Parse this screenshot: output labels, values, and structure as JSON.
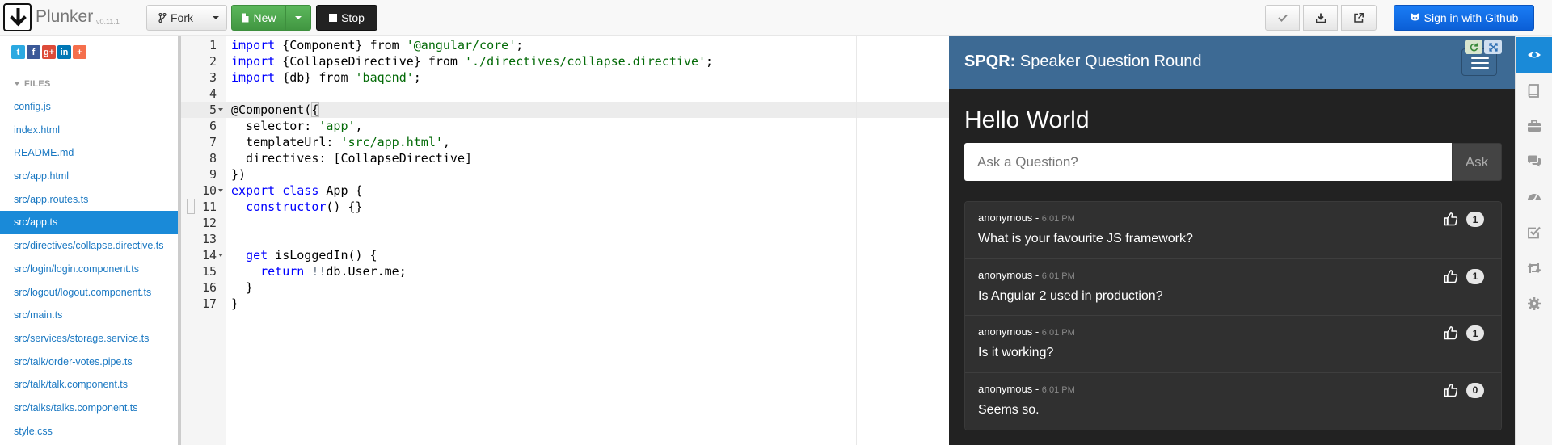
{
  "app": {
    "name": "Plunker",
    "version": "v0.11.1"
  },
  "toolbar": {
    "fork_label": "Fork",
    "new_label": "New",
    "stop_label": "Stop",
    "signin_label": "Sign in with Github"
  },
  "social": {
    "items": [
      {
        "icon": "twitter-icon",
        "glyph": "t",
        "color": "#2ba9e1"
      },
      {
        "icon": "facebook-icon",
        "glyph": "f",
        "color": "#3b5998"
      },
      {
        "icon": "google-plus-icon",
        "glyph": "g+",
        "color": "#dd4b39"
      },
      {
        "icon": "linkedin-icon",
        "glyph": "in",
        "color": "#0077b5"
      },
      {
        "icon": "share-plus-icon",
        "glyph": "+",
        "color": "#f56f4c"
      }
    ]
  },
  "files": {
    "header": "FILES",
    "items": [
      {
        "name": "config.js"
      },
      {
        "name": "index.html"
      },
      {
        "name": "README.md"
      },
      {
        "name": "src/app.html"
      },
      {
        "name": "src/app.routes.ts"
      },
      {
        "name": "src/app.ts",
        "active": true
      },
      {
        "name": "src/directives/collapse.directive.ts"
      },
      {
        "name": "src/login/login.component.ts"
      },
      {
        "name": "src/logout/logout.component.ts"
      },
      {
        "name": "src/main.ts"
      },
      {
        "name": "src/services/storage.service.ts"
      },
      {
        "name": "src/talk/order-votes.pipe.ts"
      },
      {
        "name": "src/talk/talk.component.ts"
      },
      {
        "name": "src/talks/talks.component.ts"
      },
      {
        "name": "style.css"
      }
    ]
  },
  "editor": {
    "active_line": 5,
    "fold_lines": [
      5,
      10,
      14
    ],
    "lines": [
      [
        [
          "k",
          "import"
        ],
        [
          "p",
          " {Component} from "
        ],
        [
          "s",
          "'@angular/core'"
        ],
        [
          "p",
          ";"
        ]
      ],
      [
        [
          "k",
          "import"
        ],
        [
          "p",
          " {CollapseDirective} from "
        ],
        [
          "s",
          "'./directives/collapse.directive'"
        ],
        [
          "p",
          ";"
        ]
      ],
      [
        [
          "k",
          "import"
        ],
        [
          "p",
          " {db} from "
        ],
        [
          "s",
          "'baqend'"
        ],
        [
          "p",
          ";"
        ]
      ],
      [],
      [
        [
          "p",
          "@Component({"
        ]
      ],
      [
        [
          "p",
          "  selector: "
        ],
        [
          "s",
          "'app'"
        ],
        [
          "p",
          ","
        ]
      ],
      [
        [
          "p",
          "  templateUrl: "
        ],
        [
          "s",
          "'src/app.html'"
        ],
        [
          "p",
          ","
        ]
      ],
      [
        [
          "p",
          "  directives: [CollapseDirective]"
        ]
      ],
      [
        [
          "p",
          "})"
        ]
      ],
      [
        [
          "k",
          "export"
        ],
        [
          "p",
          " "
        ],
        [
          "k",
          "class"
        ],
        [
          "p",
          " App {"
        ]
      ],
      [
        [
          "p",
          "  "
        ],
        [
          "k",
          "constructor"
        ],
        [
          "p",
          "() {}"
        ]
      ],
      [],
      [],
      [
        [
          "p",
          "  "
        ],
        [
          "k",
          "get"
        ],
        [
          "p",
          " isLoggedIn() {"
        ]
      ],
      [
        [
          "p",
          "    "
        ],
        [
          "k",
          "return"
        ],
        [
          "p",
          " "
        ],
        [
          "o",
          "!!"
        ],
        [
          "p",
          "db.User.me;"
        ]
      ],
      [
        [
          "p",
          "  }"
        ]
      ],
      [
        [
          "p",
          "}"
        ]
      ]
    ]
  },
  "preview": {
    "title_bold": "SPQR:",
    "title_rest": " Speaker Question Round",
    "heading": "Hello World",
    "ask_placeholder": "Ask a Question?",
    "ask_button": "Ask",
    "questions": [
      {
        "author": "anonymous",
        "time": "6:01 PM",
        "text": "What is your favourite JS framework?",
        "votes": 1
      },
      {
        "author": "anonymous",
        "time": "6:01 PM",
        "text": "Is Angular 2 used in production?",
        "votes": 1
      },
      {
        "author": "anonymous",
        "time": "6:01 PM",
        "text": "Is it working?",
        "votes": 1
      },
      {
        "author": "anonymous",
        "time": "6:01 PM",
        "text": "Seems so.",
        "votes": 0
      }
    ]
  },
  "right_bar": {
    "items": [
      {
        "icon": "eye-icon",
        "active": true
      },
      {
        "icon": "book-icon"
      },
      {
        "icon": "briefcase-icon"
      },
      {
        "icon": "comments-icon"
      },
      {
        "icon": "dashboard-icon"
      },
      {
        "icon": "checkbox-icon"
      },
      {
        "icon": "retweet-icon"
      },
      {
        "icon": "cog-icon"
      }
    ]
  },
  "colors": {
    "keyword": "#0000ff",
    "string": "#036a07",
    "operator": "#687687",
    "accent": "#1a8ad8",
    "preview_header": "#3d6a94"
  }
}
